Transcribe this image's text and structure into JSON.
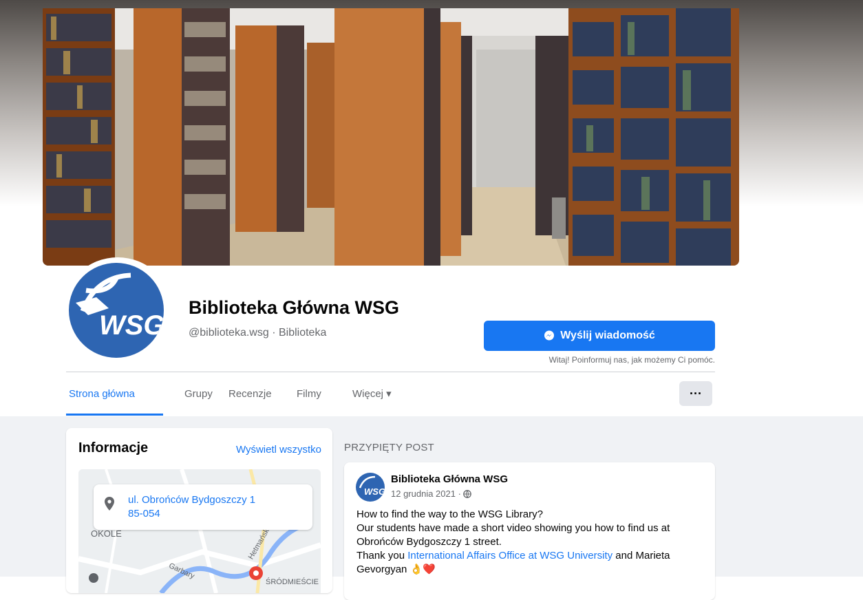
{
  "page": {
    "name": "Biblioteka Główna WSG",
    "handle_category": "@biblioteka.wsg · Biblioteka",
    "avatar_text": "WSG"
  },
  "actions": {
    "message_button": "Wyślij wiadomość",
    "message_hint": "Witaj! Poinformuj nas, jak możemy Ci pomóc.",
    "more_button": "···"
  },
  "tabs": [
    {
      "label": "Strona główna",
      "active": true
    },
    {
      "label": "Grupy",
      "active": false
    },
    {
      "label": "Recenzje",
      "active": false
    },
    {
      "label": "Filmy",
      "active": false
    },
    {
      "label": "Więcej ▾",
      "active": false
    }
  ],
  "info": {
    "title": "Informacje",
    "view_all": "Wyświetl wszystko",
    "address_line1": "ul. Obrońców Bydgoszczy 1",
    "address_line2": "85-054",
    "map_labels": [
      "OKOLE",
      "Garbary",
      "Hetmańska",
      "ŚRÓDMIEŚCIE"
    ]
  },
  "pinned": {
    "section_title": "PRZYPIĘTY POST",
    "author": "Biblioteka Główna WSG",
    "date": "12 grudnia 2021 ·",
    "lines": [
      "How to find the way to the WSG Library?",
      "Our students have made a short video showing you how to find us at",
      "Obrońców Bydgoszczy 1 street."
    ],
    "thanks_prefix": "Thank you ",
    "thanks_link": "International Affairs Office at WSG University",
    "thanks_suffix": " and Marieta",
    "last_line": "Gevorgyan 👌❤️"
  },
  "colors": {
    "accent": "#1877f2",
    "avatar_blue": "#2e65b2",
    "background": "#f0f2f5",
    "muted_text": "#65676b"
  },
  "icons": [
    "messenger-icon",
    "globe-icon",
    "location-pin-icon",
    "chevron-down-icon",
    "more-dots-icon"
  ]
}
